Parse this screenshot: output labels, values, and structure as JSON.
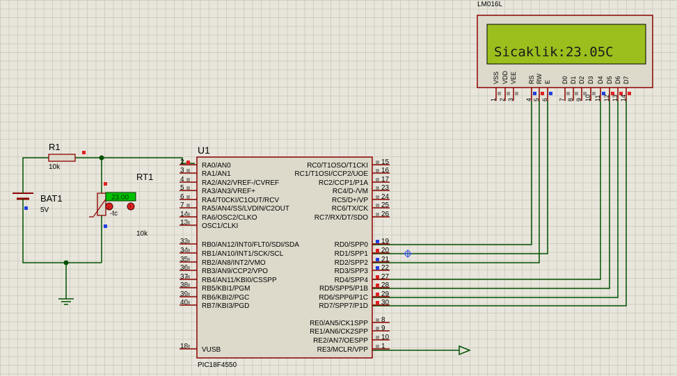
{
  "lcd": {
    "model": "LM016L",
    "display": "Sicaklik:23.05C",
    "pins": [
      {
        "num": "1",
        "name": "VSS"
      },
      {
        "num": "2",
        "name": "VDD"
      },
      {
        "num": "3",
        "name": "VEE"
      },
      {
        "num": "4",
        "name": "RS"
      },
      {
        "num": "5",
        "name": "RW"
      },
      {
        "num": "6",
        "name": "E"
      },
      {
        "num": "7",
        "name": "D0"
      },
      {
        "num": "8",
        "name": "D1"
      },
      {
        "num": "9",
        "name": "D2"
      },
      {
        "num": "10",
        "name": "D3"
      },
      {
        "num": "11",
        "name": "D4"
      },
      {
        "num": "12",
        "name": "D5"
      },
      {
        "num": "13",
        "name": "D6"
      },
      {
        "num": "14",
        "name": "D7"
      }
    ]
  },
  "mcu": {
    "ref": "U1",
    "part": "PIC18F4550",
    "left_pins": [
      {
        "num": "2",
        "label": "RA0/AN0"
      },
      {
        "num": "3",
        "label": "RA1/AN1"
      },
      {
        "num": "4",
        "label": "RA2/AN2/VREF-/CVREF"
      },
      {
        "num": "5",
        "label": "RA3/AN3/VREF+"
      },
      {
        "num": "6",
        "label": "RA4/T0CKI/C1OUT/RCV"
      },
      {
        "num": "7",
        "label": "RA5/AN4/SS/LVDIN/C2OUT"
      },
      {
        "num": "14",
        "label": "RA6/OSC2/CLKO"
      },
      {
        "num": "13",
        "label": "OSC1/CLKI"
      },
      {
        "num": "33",
        "label": "RB0/AN12/INT0/FLT0/SDI/SDA"
      },
      {
        "num": "34",
        "label": "RB1/AN10/INT1/SCK/SCL"
      },
      {
        "num": "35",
        "label": "RB2/AN8/INT2/VMO"
      },
      {
        "num": "36",
        "label": "RB3/AN9/CCP2/VPO"
      },
      {
        "num": "37",
        "label": "RB4/AN11/KBI0/CSSPP"
      },
      {
        "num": "38",
        "label": "RB5/KBI1/PGM"
      },
      {
        "num": "39",
        "label": "RB6/KBI2/PGC"
      },
      {
        "num": "40",
        "label": "RB7/KBI3/PGD"
      },
      {
        "num": "18",
        "label": "VUSB"
      }
    ],
    "right_pins": [
      {
        "num": "15",
        "label": "RC0/T1OSO/T1CKI"
      },
      {
        "num": "16",
        "label": "RC1/T1OSI/CCP2/UOE"
      },
      {
        "num": "17",
        "label": "RC2/CCP1/P1A"
      },
      {
        "num": "23",
        "label": "RC4/D-/VM"
      },
      {
        "num": "24",
        "label": "RC5/D+/VP"
      },
      {
        "num": "25",
        "label": "RC6/TX/CK"
      },
      {
        "num": "26",
        "label": "RC7/RX/DT/SDO"
      },
      {
        "num": "19",
        "label": "RD0/SPP0"
      },
      {
        "num": "20",
        "label": "RD1/SPP1"
      },
      {
        "num": "21",
        "label": "RD2/SPP2"
      },
      {
        "num": "22",
        "label": "RD3/SPP3"
      },
      {
        "num": "27",
        "label": "RD4/SPP4"
      },
      {
        "num": "28",
        "label": "RD5/SPP5/P1B"
      },
      {
        "num": "29",
        "label": "RD6/SPP6/P1C"
      },
      {
        "num": "30",
        "label": "RD7/SPP7/P1D"
      },
      {
        "num": "8",
        "label": "RE0/AN5/CK1SPP"
      },
      {
        "num": "9",
        "label": "RE1/AN6/CK2SPP"
      },
      {
        "num": "10",
        "label": "RE2/AN7/OESPP"
      },
      {
        "num": "1",
        "label": "RE3/MCLR/VPP"
      }
    ]
  },
  "r1": {
    "ref": "R1",
    "value": "10k"
  },
  "bat1": {
    "ref": "BAT1",
    "value": "5V"
  },
  "rt1": {
    "ref": "RT1",
    "value": "10k",
    "reading": "23.00",
    "tc_label": "-tc"
  },
  "colors": {
    "wire": "#005000",
    "body_outline": "#8b0000",
    "body_fill": "#ddd9cb",
    "lcd_screen": "#9bbf1d",
    "probe_red": "#e02020",
    "probe_blue": "#2040e0",
    "reading_bg": "#00c000"
  }
}
